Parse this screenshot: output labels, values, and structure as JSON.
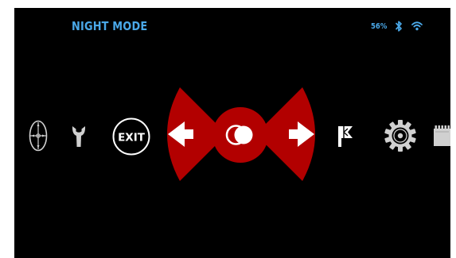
{
  "header": {
    "title": "NIGHT MODE",
    "battery": "56%"
  },
  "menu": {
    "exit_label": "EXIT",
    "items": [
      {
        "name": "reticle-icon"
      },
      {
        "name": "wrench-icon"
      },
      {
        "name": "exit-button"
      },
      {
        "name": "arrow-left-icon"
      },
      {
        "name": "night-mode-icon"
      },
      {
        "name": "arrow-right-icon"
      },
      {
        "name": "flag-icon"
      },
      {
        "name": "gear-icon"
      },
      {
        "name": "sd-card-icon"
      }
    ]
  },
  "colors": {
    "background": "#000000",
    "accent_blue": "#4aa8e8",
    "selector_red": "#b20000",
    "icon_grey": "#d0d0d0",
    "icon_white": "#ffffff"
  }
}
